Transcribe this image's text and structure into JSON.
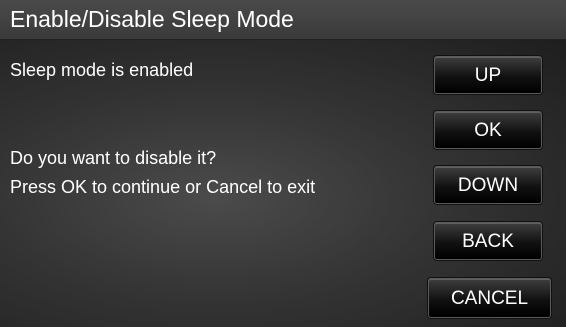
{
  "header": {
    "title": "Enable/Disable Sleep Mode"
  },
  "message": {
    "status": "Sleep mode is enabled",
    "question": "Do you want to disable it?",
    "instruction": "Press OK to continue or Cancel to exit"
  },
  "buttons": {
    "up": "UP",
    "ok": "OK",
    "down": "DOWN",
    "back": "BACK",
    "cancel": "CANCEL"
  }
}
